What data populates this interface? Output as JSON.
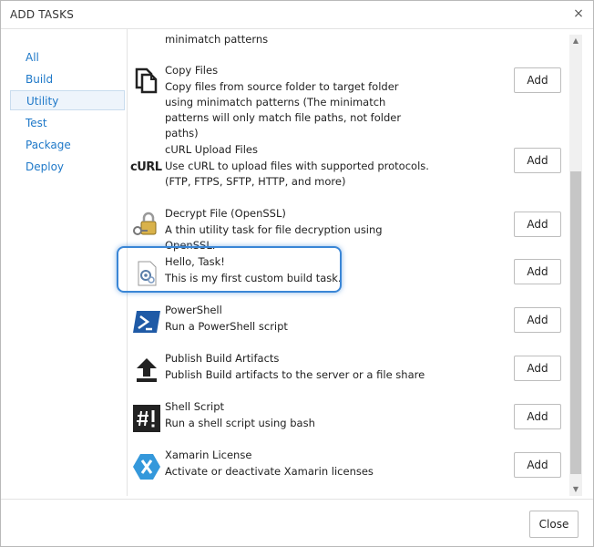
{
  "dialog": {
    "title": "ADD TASKS",
    "close_glyph": "×",
    "close_label": "Close"
  },
  "sidebar": {
    "items": [
      {
        "label": "All",
        "active": false
      },
      {
        "label": "Build",
        "active": false
      },
      {
        "label": "Utility",
        "active": true
      },
      {
        "label": "Test",
        "active": false
      },
      {
        "label": "Package",
        "active": false
      },
      {
        "label": "Deploy",
        "active": false
      }
    ]
  },
  "tasks": [
    {
      "name": "",
      "desc": "minimatch patterns",
      "icon": "none"
    },
    {
      "name": "Copy Files",
      "desc": "Copy files from source folder to target folder using minimatch patterns (The minimatch patterns will only match file paths, not folder paths)",
      "icon": "copy-files-icon"
    },
    {
      "name": "cURL Upload Files",
      "desc": "Use cURL to upload files with supported protocols. (FTP, FTPS, SFTP, HTTP, and more)",
      "icon": "curl-icon"
    },
    {
      "name": "Decrypt File (OpenSSL)",
      "desc": "A thin utility task for file decryption using OpenSSL.",
      "icon": "lock-key-icon"
    },
    {
      "name": "Hello, Task!",
      "desc": "This is my first custom build task.",
      "icon": "custom-task-icon"
    },
    {
      "name": "PowerShell",
      "desc": "Run a PowerShell script",
      "icon": "powershell-icon"
    },
    {
      "name": "Publish Build Artifacts",
      "desc": "Publish Build artifacts to the server or a file share",
      "icon": "upload-arrow-icon"
    },
    {
      "name": "Shell Script",
      "desc": "Run a shell script using bash",
      "icon": "shell-script-icon"
    },
    {
      "name": "Xamarin License",
      "desc": "Activate or deactivate Xamarin licenses",
      "icon": "xamarin-icon"
    }
  ],
  "add_label": "Add",
  "colors": {
    "link": "#1e78c8",
    "highlight": "#3a86d6",
    "powershell": "#1f5aa6",
    "xamarin": "#3498db"
  }
}
